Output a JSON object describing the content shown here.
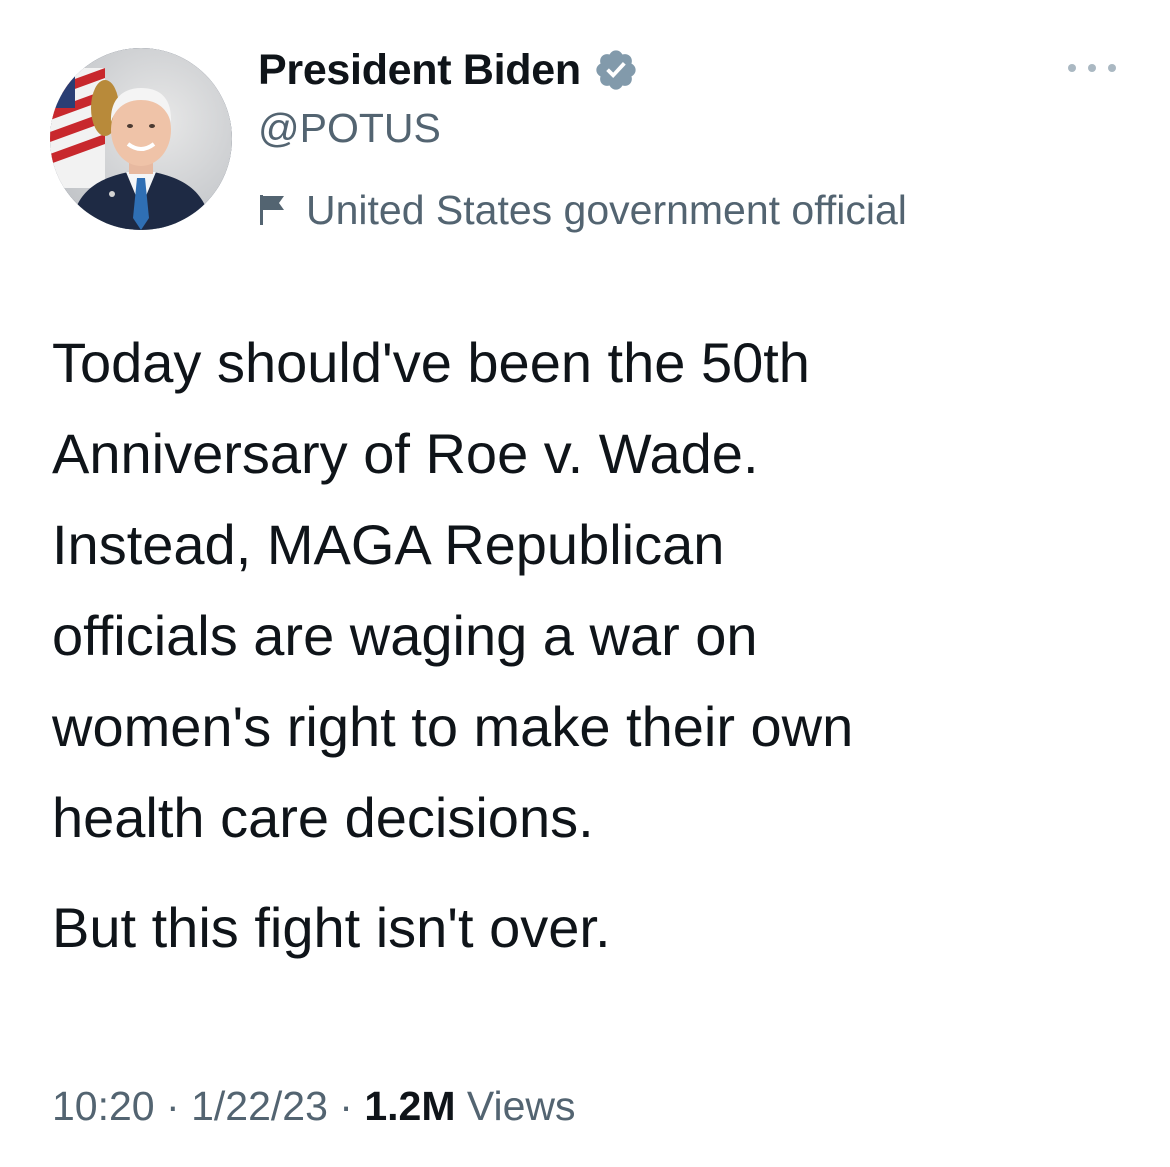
{
  "author": {
    "display_name": "President Biden",
    "handle": "@POTUS",
    "label": "United States government official",
    "verified": true,
    "avatar_icon": "profile-photo"
  },
  "tweet": {
    "paragraph_1_lines": [
      "Today should've been the 50th",
      "Anniversary of Roe v. Wade.",
      "Instead, MAGA Republican",
      "officials are waging a war on",
      "women's right to make their own",
      "health care decisions."
    ],
    "paragraph_2": "But this fight isn't over."
  },
  "meta": {
    "time": "10:20",
    "separator": "·",
    "date": "1/22/23",
    "views_count": "1.2M",
    "views_label": "Views"
  },
  "icons": {
    "verified": "verified-badge-icon",
    "more": "more-options-icon",
    "label": "flag-icon"
  },
  "colors": {
    "text_primary": "#0f1419",
    "text_secondary": "#536471",
    "verified_badge": "#829aab",
    "more_dots": "#aab8c2"
  }
}
